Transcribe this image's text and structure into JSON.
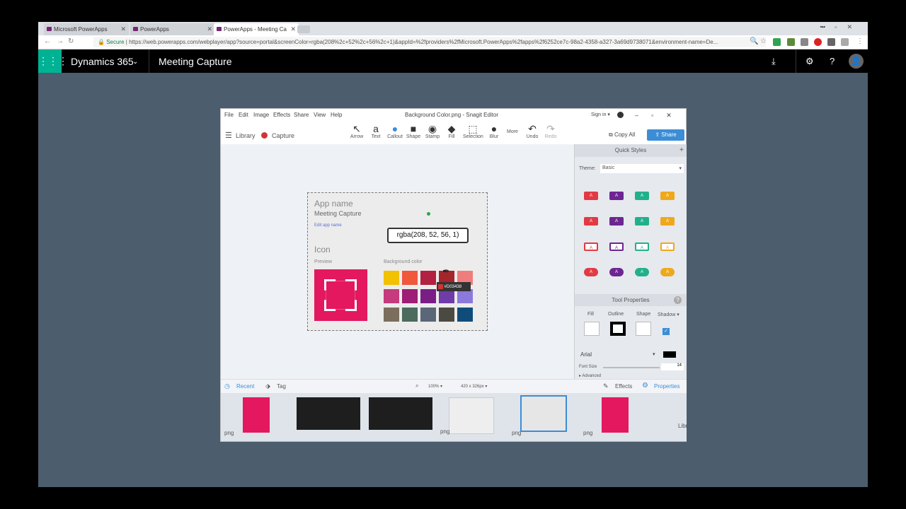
{
  "browser": {
    "tabs": [
      {
        "label": "Microsoft PowerApps"
      },
      {
        "label": "PowerApps"
      },
      {
        "label": "PowerApps - Meeting Ca"
      }
    ],
    "secure": "Secure",
    "url": "https://web.powerapps.com/webplayer/app?source=portal&screenColor=rgba(208%2c+52%2c+56%2c+1)&appId=%2fproviders%2fMicrosoft.PowerApps%2fapps%2f6252ce7c-98a2-4358-a327-3a69d9738071&environment-name=De..."
  },
  "app": {
    "product": "Dynamics 365",
    "name": "Meeting Capture"
  },
  "snagit": {
    "menu": [
      "File",
      "Edit",
      "Image",
      "Effects",
      "Share",
      "View",
      "Help"
    ],
    "title": "Background Color.png - Snagit Editor",
    "signin": "Sign in ▾",
    "library": "Library",
    "capture": "Capture",
    "tools": [
      {
        "label": "Arrow",
        "glyph": "↖"
      },
      {
        "label": "Text",
        "glyph": "a"
      },
      {
        "label": "Callout",
        "glyph": "💬"
      },
      {
        "label": "Shape",
        "glyph": "■"
      },
      {
        "label": "Stamp",
        "glyph": "◉"
      },
      {
        "label": "Fill",
        "glyph": "◆"
      },
      {
        "label": "Selection",
        "glyph": "⬚"
      },
      {
        "label": "Blur",
        "glyph": "💧"
      }
    ],
    "more": "More",
    "undo": "Undo",
    "redo": "Redo",
    "copy_all": "Copy All",
    "share": "Share",
    "quick_styles": "Quick Styles",
    "theme_label": "Theme:",
    "theme_value": "Basic",
    "tool_properties": "Tool Properties",
    "prop_labels": {
      "fill": "Fill",
      "outline": "Outline",
      "shape": "Shape",
      "shadow": "Shadow ▾"
    },
    "font": "Arial",
    "font_size_label": "Font Size",
    "font_size": "14",
    "advanced": "Advanced",
    "recent": "Recent",
    "tag": "Tag",
    "zoom": "100% ▾",
    "dims": "420 x 326px ▾",
    "effects": "Effects",
    "properties": "Properties",
    "thumb_label": "png",
    "library_short": "Libr"
  },
  "capture_img": {
    "app_name_label": "App name",
    "app_name_value": "Meeting Capture",
    "edit_link": "Edit app name",
    "icon_label": "Icon",
    "preview_label": "Preview",
    "bg_color_label": "Background color",
    "callout": "rgba(208, 52, 56, 1)",
    "hex": "#D03438"
  },
  "colors": {
    "accent": "#00b294",
    "selected": "#d03438",
    "preview": "#e3185e",
    "swatches": [
      "#f2c100",
      "#f0573b",
      "#b2213f",
      "#a4262c",
      "#ef7d7d",
      "#c53b7d",
      "#9e1d75",
      "#7a1e86",
      "#6f3ca8",
      "#8b7adc",
      "#7c6e5d",
      "#4b6b5c",
      "#5a6778",
      "#4a4a42",
      "#104c7a"
    ]
  }
}
